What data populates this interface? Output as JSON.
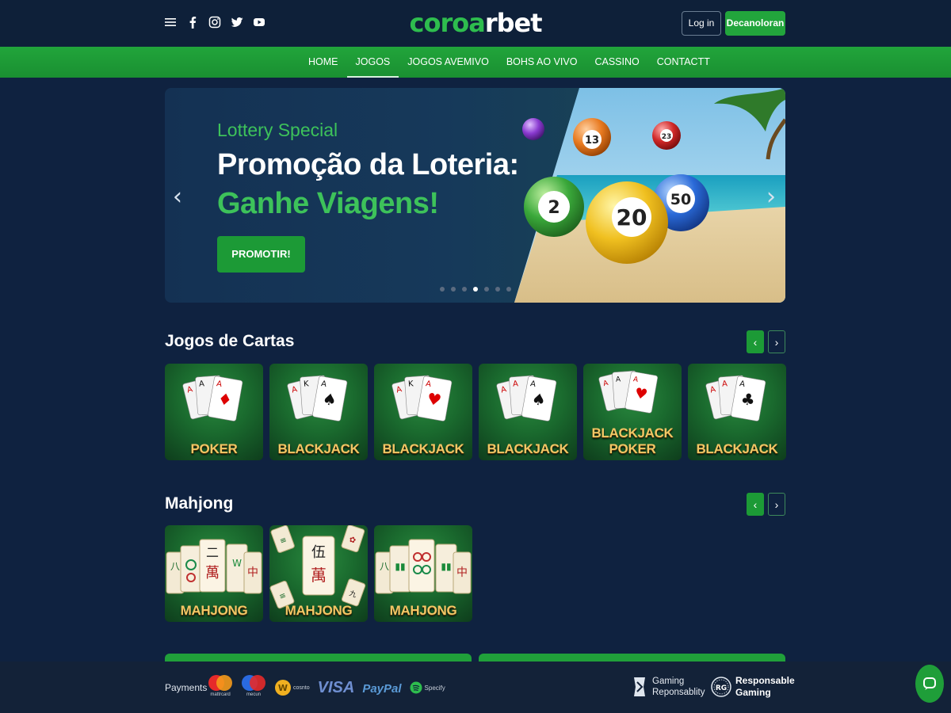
{
  "header": {
    "logo_part1": "coro",
    "logo_part2": "a",
    "logo_part3": "rbet",
    "login_label": "Log in",
    "signup_label": "Decanoloran",
    "social_icons": [
      "menu-icon",
      "facebook-icon",
      "instagram-icon",
      "twitter-icon",
      "youtube-icon"
    ]
  },
  "nav": {
    "items": [
      {
        "label": "HOME",
        "active": false
      },
      {
        "label": "JOGOS",
        "active": true
      },
      {
        "label": "JOGOS AVEMIVO",
        "active": false
      },
      {
        "label": "BOHS AO VIVO",
        "active": false
      },
      {
        "label": "CASSINO",
        "active": false
      },
      {
        "label": "CONTACTT",
        "active": false
      }
    ]
  },
  "banner": {
    "subtitle": "Lottery Special",
    "title_line1": "Promoção da Loteria:",
    "title_line2": "Ganhe Viagens!",
    "button_label": "PROMOTIR!",
    "prev_arrow": "‹",
    "next_arrow": "›",
    "slide_count": 7,
    "active_slide": 4,
    "balls": [
      "2",
      "20",
      "50",
      "13",
      "23"
    ]
  },
  "sections": {
    "cartas": {
      "title": "Jogos de Cartas",
      "prev": "‹",
      "next": "›",
      "cards": [
        {
          "label": "POKER",
          "suit": "♦"
        },
        {
          "label": "BLACKJACK",
          "suit": "♠"
        },
        {
          "label": "BLACKJACK",
          "suit": "♥"
        },
        {
          "label": "BLACKJACK",
          "suit": "♠"
        },
        {
          "label_line1": "BLACKJACK",
          "label_line2": "POKER",
          "suit": "♥"
        },
        {
          "label": "BLACKJACK",
          "suit": "♣"
        }
      ]
    },
    "mahjong": {
      "title": "Mahjong",
      "prev": "‹",
      "next": "›",
      "cards": [
        {
          "label": "MAHJONG"
        },
        {
          "label": "MAHJONG"
        },
        {
          "label": "MAHJONG"
        }
      ]
    }
  },
  "footer": {
    "payments_label": "Payments",
    "mastercard_caption": "mattrcard",
    "maestro_caption": "mecun",
    "coin_caption": "cosnto",
    "visa": "VISA",
    "paypal": "PayPal",
    "spotify": "Specify",
    "gaming_line1": "Gaming",
    "gaming_line2": "Reponsablity",
    "rg_badge": "RG",
    "responsible_line1": "Responsable",
    "responsible_line2": "Gaming"
  },
  "colors": {
    "accent": "#22a53c",
    "background": "#0f2240",
    "card_label": "#f1c766"
  }
}
